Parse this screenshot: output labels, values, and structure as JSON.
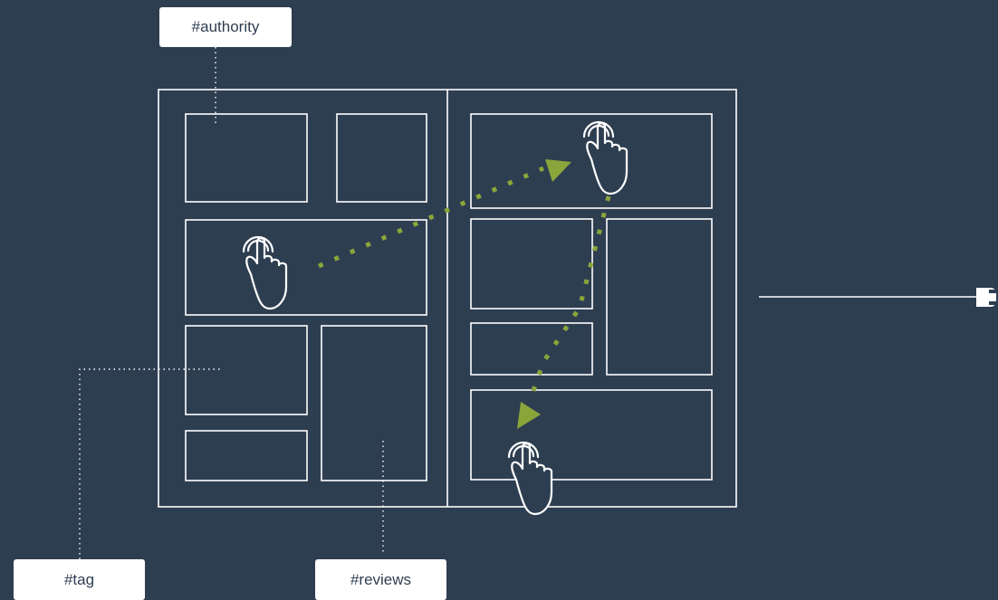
{
  "labels": {
    "authority": "#authority",
    "tag": "#tag",
    "reviews": "#reviews"
  },
  "colors": {
    "background": "#2e3e51",
    "stroke": "#ffffff",
    "accent": "#8aa63a"
  },
  "icons": [
    "hand-tap-icon",
    "hand-tap-icon",
    "hand-tap-icon",
    "plug-icon"
  ]
}
